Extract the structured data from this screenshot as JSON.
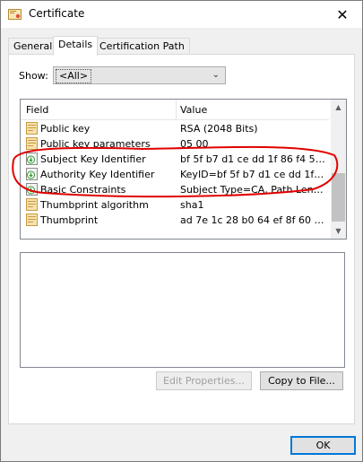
{
  "window": {
    "title": "Certificate"
  },
  "tabs": [
    {
      "label": "General"
    },
    {
      "label": "Details"
    },
    {
      "label": "Certification Path"
    }
  ],
  "show": {
    "label": "Show:",
    "selected": "<All>"
  },
  "list": {
    "headers": {
      "field": "Field",
      "value": "Value"
    },
    "rows": [
      {
        "field": "Public key",
        "value": "RSA (2048 Bits)",
        "icon": "cert-field-icon"
      },
      {
        "field": "Public key parameters",
        "value": "05 00",
        "icon": "cert-field-icon"
      },
      {
        "field": "Subject Key Identifier",
        "value": "bf 5f b7 d1 ce dd 1f 86 f4 5b 5...",
        "icon": "cert-extension-icon"
      },
      {
        "field": "Authority Key Identifier",
        "value": "KeyID=bf 5f b7 d1 ce dd 1f 86...",
        "icon": "cert-extension-icon"
      },
      {
        "field": "Basic Constraints",
        "value": "Subject Type=CA, Path Lengt...",
        "icon": "cert-extension-icon"
      },
      {
        "field": "Thumbprint algorithm",
        "value": "sha1",
        "icon": "cert-field-icon"
      },
      {
        "field": "Thumbprint",
        "value": "ad 7e 1c 28 b0 64 ef 8f 60 03 ...",
        "icon": "cert-field-icon"
      }
    ]
  },
  "buttons": {
    "edit_properties": "Edit Properties...",
    "copy_to_file": "Copy to File...",
    "ok": "OK"
  },
  "annotation": {
    "color": "#e00000"
  }
}
